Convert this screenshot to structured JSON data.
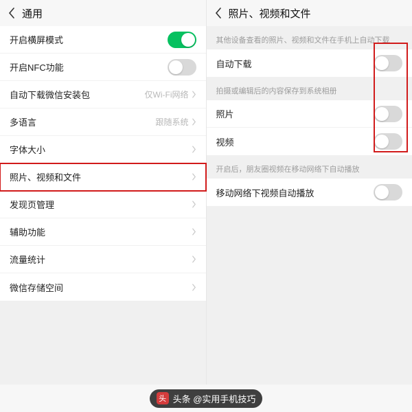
{
  "left": {
    "title": "通用",
    "rows": [
      {
        "label": "开启横屏模式",
        "kind": "toggle",
        "on": true
      },
      {
        "label": "开启NFC功能",
        "kind": "toggle",
        "on": false
      },
      {
        "label": "自动下载微信安装包",
        "kind": "value",
        "value": "仅Wi-Fi网络"
      },
      {
        "label": "多语言",
        "kind": "value",
        "value": "跟随系统"
      },
      {
        "label": "字体大小",
        "kind": "nav"
      },
      {
        "label": "照片、视频和文件",
        "kind": "nav",
        "highlighted": true
      },
      {
        "label": "发现页管理",
        "kind": "nav"
      },
      {
        "label": "辅助功能",
        "kind": "nav"
      },
      {
        "label": "流量统计",
        "kind": "nav"
      },
      {
        "label": "微信存储空间",
        "kind": "nav"
      }
    ]
  },
  "right": {
    "title": "照片、视频和文件",
    "sections": [
      {
        "caption": "其他设备查看的照片、视频和文件在手机上自动下载",
        "rows": [
          {
            "label": "自动下载",
            "kind": "toggle",
            "on": false
          }
        ]
      },
      {
        "caption": "拍摄或编辑后的内容保存到系统相册",
        "rows": [
          {
            "label": "照片",
            "kind": "toggle",
            "on": false
          },
          {
            "label": "视频",
            "kind": "toggle",
            "on": false
          }
        ]
      },
      {
        "caption": "开启后，朋友圈视频在移动网络下自动播放",
        "rows": [
          {
            "label": "移动网络下视频自动播放",
            "kind": "toggle",
            "on": false
          }
        ]
      }
    ]
  },
  "watermark": {
    "icon_text": "头",
    "text": "头条 @实用手机技巧"
  }
}
